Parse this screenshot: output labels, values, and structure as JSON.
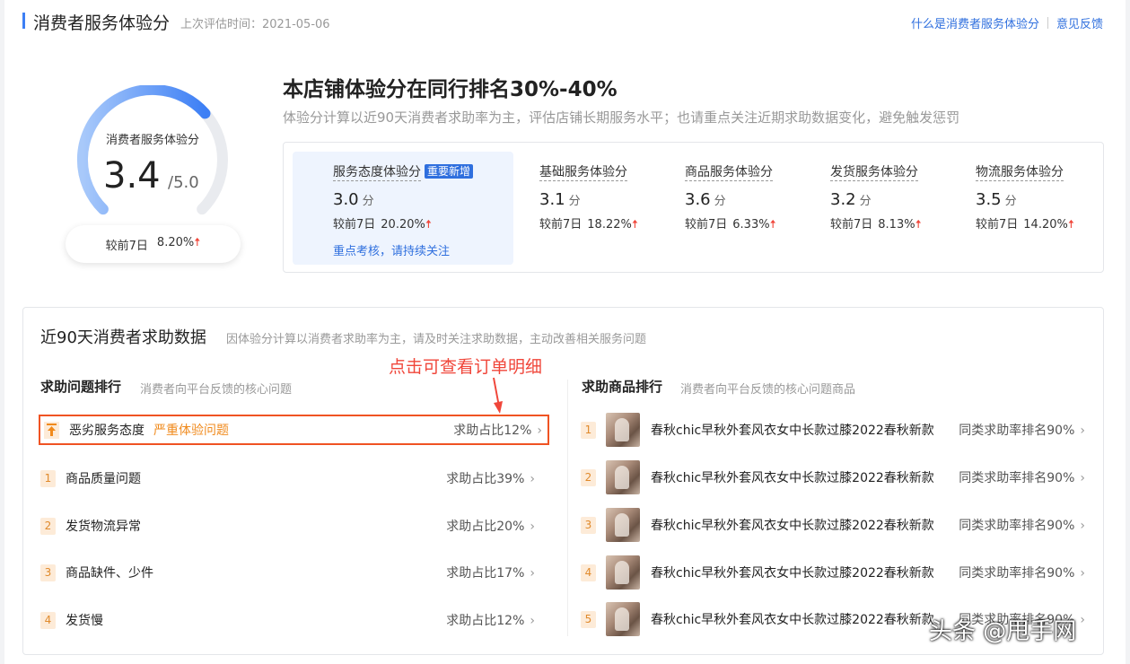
{
  "header": {
    "title": "消费者服务体验分",
    "last_eval": "上次评估时间：2021-05-06",
    "link_what": "什么是消费者服务体验分",
    "link_feedback": "意见反馈"
  },
  "gauge": {
    "label": "消费者服务体验分",
    "score": "3.4",
    "max": "/5.0",
    "score_fraction": 0.68,
    "compare_label": "较前7日",
    "compare_value": "8.20%",
    "trend_icon": "arrow-up-icon",
    "gradient_colors": [
      "#a8c9fa",
      "#3d7ff5"
    ],
    "track_color": "#e9ebef"
  },
  "rank": {
    "title": "本店铺体验分在同行排名30%-40%",
    "desc": "体验分计算以近90天消费者求助率为主，评估店铺长期服务水平；也请重点关注近期求助数据变化，避免触发惩罚"
  },
  "cards": [
    {
      "name": "服务态度体验分",
      "badge": "重要新增",
      "score": "3.0",
      "unit": "分",
      "cmp_label": "较前7日",
      "cmp_value": "20.20%",
      "note": "重点考核，请持续关注"
    },
    {
      "name": "基础服务体验分",
      "score": "3.1",
      "unit": "分",
      "cmp_label": "较前7日",
      "cmp_value": "18.22%"
    },
    {
      "name": "商品服务体验分",
      "score": "3.6",
      "unit": "分",
      "cmp_label": "较前7日",
      "cmp_value": "6.33%"
    },
    {
      "name": "发货服务体验分",
      "score": "3.2",
      "unit": "分",
      "cmp_label": "较前7日",
      "cmp_value": "8.13%"
    },
    {
      "name": "物流服务体验分",
      "score": "3.5",
      "unit": "分",
      "cmp_label": "较前7日",
      "cmp_value": "14.20%"
    }
  ],
  "help": {
    "title": "近90天消费者求助数据",
    "subtitle": "因体验分计算以消费者求助率为主，请及时关注求助数据，主动改善相关服务问题",
    "annotation": "点击可查看订单明细",
    "issues_title": "求助问题排行",
    "issues_sub": "消费者向平台反馈的核心问题",
    "issues": [
      {
        "rank": "",
        "label": "恶劣服务态度",
        "tag": "严重体验问题",
        "pct": "求助占比12%"
      },
      {
        "rank": "1",
        "label": "商品质量问题",
        "pct": "求助占比39%"
      },
      {
        "rank": "2",
        "label": "发货物流异常",
        "pct": "求助占比20%"
      },
      {
        "rank": "3",
        "label": "商品缺件、少件",
        "pct": "求助占比17%"
      },
      {
        "rank": "4",
        "label": "发货慢",
        "pct": "求助占比12%"
      }
    ],
    "products_title": "求助商品排行",
    "products_sub": "消费者向平台反馈的核心问题商品",
    "products": [
      {
        "rank": "1",
        "name": "春秋chic早秋外套风衣女中长款过膝2022春秋新款",
        "pct": "同类求助率排名90%"
      },
      {
        "rank": "2",
        "name": "春秋chic早秋外套风衣女中长款过膝2022春秋新款",
        "pct": "同类求助率排名90%"
      },
      {
        "rank": "3",
        "name": "春秋chic早秋外套风衣女中长款过膝2022春秋新款",
        "pct": "同类求助率排名90%"
      },
      {
        "rank": "4",
        "name": "春秋chic早秋外套风衣女中长款过膝2022春秋新款",
        "pct": "同类求助率排名90%"
      },
      {
        "rank": "5",
        "name": "春秋chic早秋外套风衣女中长款过膝2022春秋新款",
        "pct": "同类求助率排名90%"
      }
    ]
  },
  "watermark": "头条 @甩手网"
}
